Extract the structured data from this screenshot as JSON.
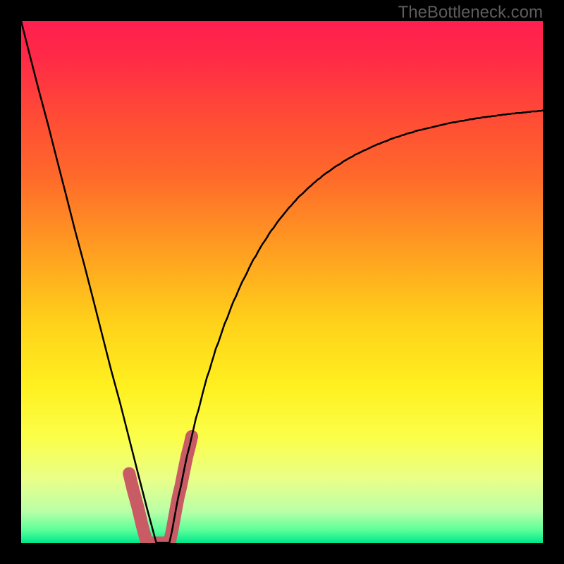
{
  "watermark": "TheBottleneck.com",
  "colors": {
    "gradient_stops": [
      {
        "offset": 0.0,
        "color": "#ff1f4f"
      },
      {
        "offset": 0.07,
        "color": "#ff2a47"
      },
      {
        "offset": 0.18,
        "color": "#ff4a36"
      },
      {
        "offset": 0.3,
        "color": "#ff6a2a"
      },
      {
        "offset": 0.45,
        "color": "#ffa220"
      },
      {
        "offset": 0.58,
        "color": "#ffd21a"
      },
      {
        "offset": 0.7,
        "color": "#fff020"
      },
      {
        "offset": 0.8,
        "color": "#fbff4a"
      },
      {
        "offset": 0.88,
        "color": "#e8ff8a"
      },
      {
        "offset": 0.94,
        "color": "#baffa8"
      },
      {
        "offset": 0.975,
        "color": "#5cff9a"
      },
      {
        "offset": 1.0,
        "color": "#00e88a"
      }
    ],
    "curve": "#000000",
    "marker": "#c95b64",
    "background": "#000000"
  },
  "chart_data": {
    "type": "line",
    "title": "",
    "xlabel": "",
    "ylabel": "",
    "xlim": [
      0,
      1
    ],
    "ylim": [
      0,
      1
    ],
    "annotations": [
      "TheBottleneck.com"
    ],
    "series": [
      {
        "name": "bottleneck-curve",
        "x": [
          0.0,
          0.017,
          0.034,
          0.052,
          0.069,
          0.086,
          0.103,
          0.121,
          0.138,
          0.155,
          0.172,
          0.19,
          0.207,
          0.224,
          0.241,
          0.259,
          0.263,
          0.268,
          0.272,
          0.276,
          0.28,
          0.284,
          0.289,
          0.293,
          0.297,
          0.301,
          0.306,
          0.31,
          0.314,
          0.318,
          0.323,
          0.327,
          0.331,
          0.335,
          0.34,
          0.344,
          0.348,
          0.352,
          0.356,
          0.361,
          0.365,
          0.369,
          0.373,
          0.378,
          0.382,
          0.386,
          0.39,
          0.395,
          0.399,
          0.403,
          0.407,
          0.412,
          0.416,
          0.42,
          0.424,
          0.429,
          0.433,
          0.437,
          0.441,
          0.445,
          0.45,
          0.454,
          0.458,
          0.462,
          0.467,
          0.471,
          0.475,
          0.479,
          0.484,
          0.488,
          0.492,
          0.496,
          0.501,
          0.505,
          0.509,
          0.513,
          0.518,
          0.522,
          0.526,
          0.53,
          0.534,
          0.539,
          0.543,
          0.547,
          0.551,
          0.556,
          0.56,
          0.564,
          0.568,
          0.573,
          0.577,
          0.581,
          0.585,
          0.59,
          0.594,
          0.598,
          0.602,
          0.607,
          0.611,
          0.615,
          0.619,
          0.623,
          0.628,
          0.632,
          0.636,
          0.64,
          0.645,
          0.649,
          0.653,
          0.657,
          0.662,
          0.666,
          0.67,
          0.674,
          0.679,
          0.683,
          0.687,
          0.691,
          0.696,
          0.7,
          0.704,
          0.708,
          0.712,
          0.717,
          0.721,
          0.725,
          0.729,
          0.734,
          0.738,
          0.742,
          0.746,
          0.751,
          0.755,
          0.759,
          0.763,
          0.768,
          0.772,
          0.776,
          0.78,
          0.785,
          0.789,
          0.793,
          0.797,
          0.801,
          0.806,
          0.81,
          0.814,
          0.818,
          0.823,
          0.827,
          0.831,
          0.835,
          0.84,
          0.844,
          0.848,
          0.852,
          0.857,
          0.861,
          0.865,
          0.869,
          0.874,
          0.878,
          0.882,
          0.886,
          0.89,
          0.895,
          0.899,
          0.903,
          0.907,
          0.912,
          0.916,
          0.92,
          0.924,
          0.929,
          0.933,
          0.937,
          0.941,
          0.946,
          0.95,
          0.954,
          0.958,
          0.963,
          0.967,
          0.971,
          0.975,
          0.979,
          0.984,
          0.988,
          0.992,
          0.996,
          1.0
        ],
        "y": [
          1.0,
          0.933,
          0.867,
          0.8,
          0.733,
          0.667,
          0.6,
          0.533,
          0.467,
          0.4,
          0.333,
          0.267,
          0.2,
          0.133,
          0.067,
          0.0,
          0.0,
          0.0,
          0.0,
          0.0,
          0.0,
          0.0,
          0.022,
          0.044,
          0.066,
          0.087,
          0.108,
          0.128,
          0.148,
          0.167,
          0.186,
          0.204,
          0.221,
          0.239,
          0.255,
          0.271,
          0.287,
          0.302,
          0.317,
          0.331,
          0.345,
          0.358,
          0.372,
          0.384,
          0.396,
          0.408,
          0.42,
          0.431,
          0.442,
          0.453,
          0.463,
          0.473,
          0.483,
          0.492,
          0.501,
          0.51,
          0.518,
          0.527,
          0.535,
          0.543,
          0.55,
          0.558,
          0.565,
          0.572,
          0.579,
          0.585,
          0.592,
          0.598,
          0.604,
          0.61,
          0.616,
          0.621,
          0.627,
          0.632,
          0.637,
          0.642,
          0.647,
          0.652,
          0.656,
          0.661,
          0.665,
          0.669,
          0.673,
          0.677,
          0.681,
          0.685,
          0.689,
          0.692,
          0.696,
          0.699,
          0.703,
          0.706,
          0.709,
          0.712,
          0.715,
          0.718,
          0.721,
          0.724,
          0.726,
          0.729,
          0.732,
          0.734,
          0.737,
          0.739,
          0.741,
          0.744,
          0.746,
          0.748,
          0.75,
          0.752,
          0.754,
          0.756,
          0.758,
          0.76,
          0.762,
          0.764,
          0.765,
          0.767,
          0.769,
          0.77,
          0.772,
          0.774,
          0.775,
          0.777,
          0.778,
          0.779,
          0.781,
          0.782,
          0.784,
          0.785,
          0.786,
          0.787,
          0.789,
          0.79,
          0.791,
          0.792,
          0.793,
          0.794,
          0.795,
          0.796,
          0.797,
          0.798,
          0.799,
          0.8,
          0.801,
          0.802,
          0.803,
          0.804,
          0.805,
          0.806,
          0.806,
          0.807,
          0.808,
          0.809,
          0.809,
          0.81,
          0.811,
          0.812,
          0.812,
          0.813,
          0.814,
          0.814,
          0.815,
          0.816,
          0.816,
          0.817,
          0.817,
          0.818,
          0.818,
          0.819,
          0.82,
          0.82,
          0.821,
          0.821,
          0.822,
          0.822,
          0.823,
          0.823,
          0.824,
          0.824,
          0.824,
          0.825,
          0.825,
          0.826,
          0.826,
          0.827,
          0.827,
          0.827,
          0.828,
          0.828,
          0.829
        ]
      }
    ],
    "marker": {
      "x": [
        0.207,
        0.215,
        0.224,
        0.232,
        0.241,
        0.249,
        0.259,
        0.263,
        0.268,
        0.272,
        0.276,
        0.28,
        0.284,
        0.289,
        0.293,
        0.297,
        0.301,
        0.306,
        0.31,
        0.314,
        0.318,
        0.323,
        0.327
      ],
      "y": [
        0.133,
        0.1,
        0.067,
        0.033,
        0.0,
        0.0,
        0.0,
        0.0,
        0.0,
        0.0,
        0.0,
        0.0,
        0.0,
        0.022,
        0.044,
        0.066,
        0.087,
        0.108,
        0.128,
        0.148,
        0.167,
        0.186,
        0.204
      ]
    }
  }
}
